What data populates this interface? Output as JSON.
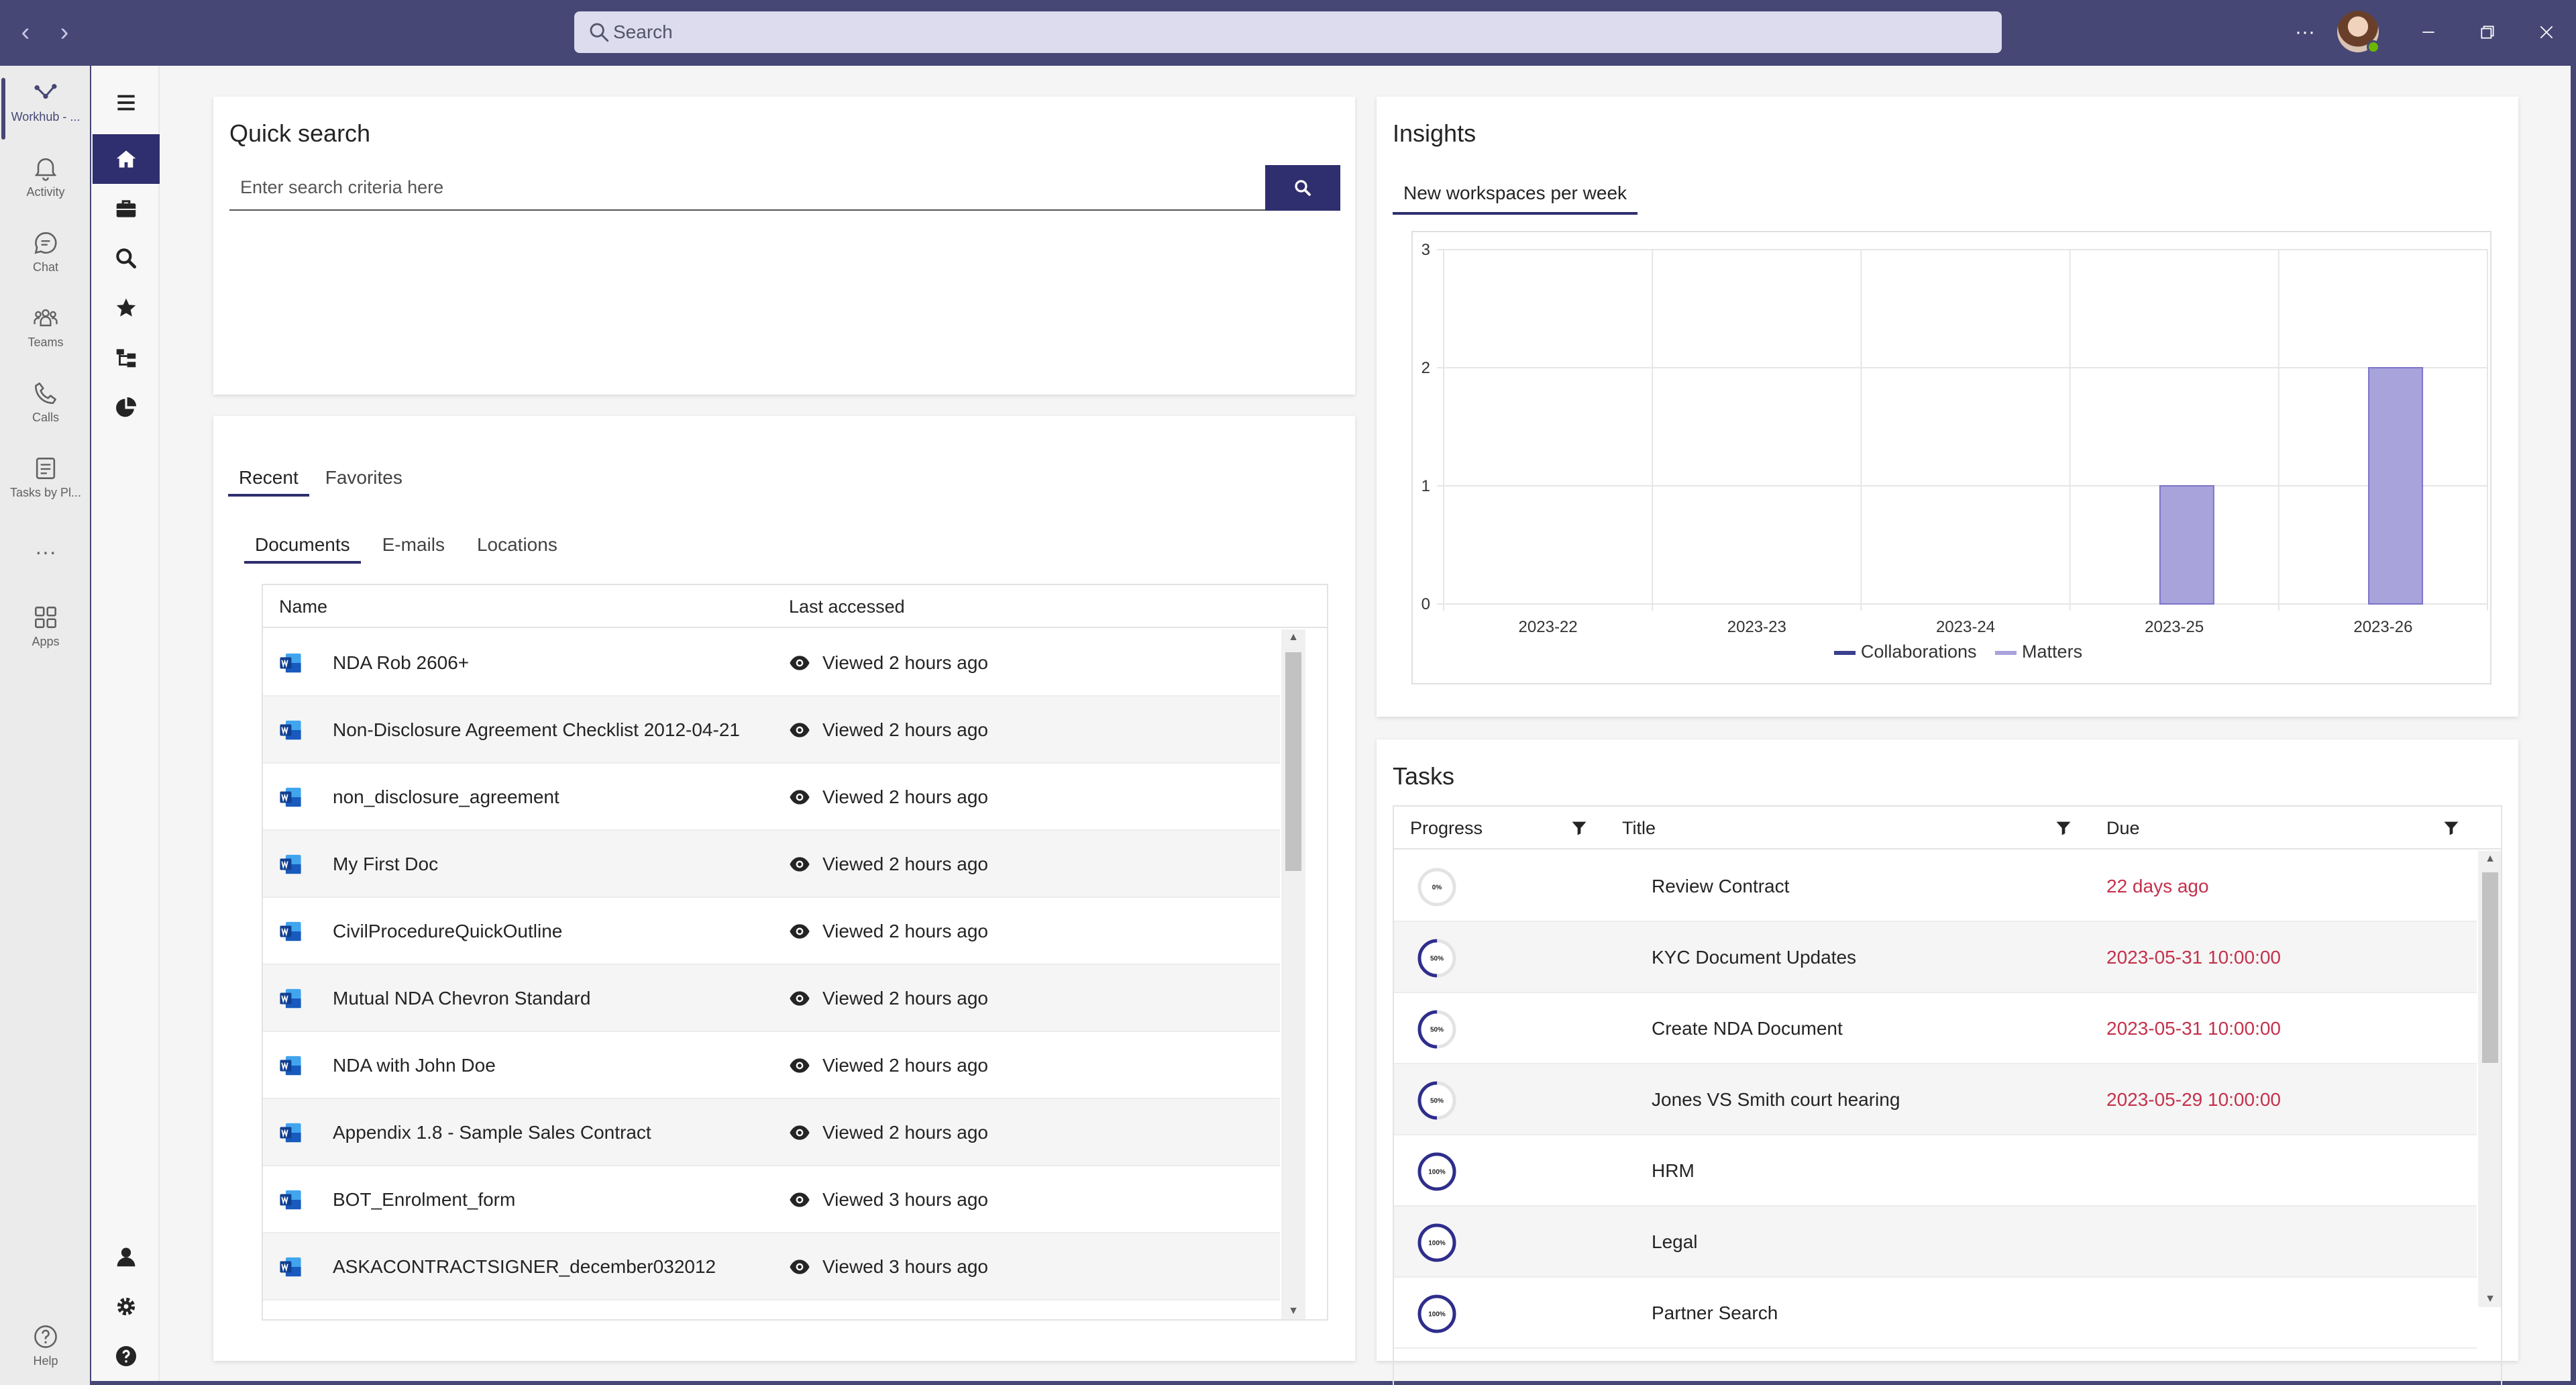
{
  "titlebar": {
    "search_placeholder": "Search",
    "more_label": "···"
  },
  "rail": {
    "items": [
      {
        "label": "Workhub - ...",
        "icon": "workhub-icon"
      },
      {
        "label": "Activity",
        "icon": "bell-icon"
      },
      {
        "label": "Chat",
        "icon": "chat-icon"
      },
      {
        "label": "Teams",
        "icon": "teams-icon"
      },
      {
        "label": "Calls",
        "icon": "phone-icon"
      },
      {
        "label": "Tasks by Pl...",
        "icon": "tasks-icon"
      },
      {
        "label": "···",
        "icon": "more-icon"
      },
      {
        "label": "Apps",
        "icon": "apps-icon"
      },
      {
        "label": "Help",
        "icon": "help-icon"
      }
    ]
  },
  "quick_search": {
    "title": "Quick search",
    "placeholder": "Enter search criteria here"
  },
  "recent": {
    "tabs": [
      "Recent",
      "Favorites"
    ],
    "subtabs": [
      "Documents",
      "E-mails",
      "Locations"
    ],
    "columns": {
      "name": "Name",
      "last_accessed": "Last accessed"
    },
    "rows": [
      {
        "name": "NDA Rob 2606+",
        "accessed": "Viewed 2 hours ago"
      },
      {
        "name": "Non-Disclosure Agreement Checklist 2012-04-21",
        "accessed": "Viewed 2 hours ago"
      },
      {
        "name": "non_disclosure_agreement",
        "accessed": "Viewed 2 hours ago"
      },
      {
        "name": "My First Doc",
        "accessed": "Viewed 2 hours ago"
      },
      {
        "name": "CivilProcedureQuickOutline",
        "accessed": "Viewed 2 hours ago"
      },
      {
        "name": "Mutual NDA Chevron Standard",
        "accessed": "Viewed 2 hours ago"
      },
      {
        "name": "NDA with John Doe",
        "accessed": "Viewed 2 hours ago"
      },
      {
        "name": "Appendix 1.8 - Sample Sales Contract",
        "accessed": "Viewed 2 hours ago"
      },
      {
        "name": "BOT_Enrolment_form",
        "accessed": "Viewed 3 hours ago"
      },
      {
        "name": "ASKACONTRACTSIGNER_december032012",
        "accessed": "Viewed 3 hours ago"
      }
    ]
  },
  "insights": {
    "title": "Insights",
    "tab": "New workspaces per week"
  },
  "chart_data": {
    "type": "bar",
    "categories": [
      "2023-22",
      "2023-23",
      "2023-24",
      "2023-25",
      "2023-26"
    ],
    "series": [
      {
        "name": "Collaborations",
        "values": [
          0,
          0,
          0,
          0,
          0
        ],
        "color": "#3b3f8c"
      },
      {
        "name": "Matters",
        "values": [
          0,
          0,
          0,
          1,
          2
        ],
        "color": "#a9a3dc"
      }
    ],
    "yticks": [
      "0",
      "1",
      "2",
      "3"
    ],
    "ylim": [
      0,
      3
    ],
    "grid": true,
    "legend": "bottom"
  },
  "tasks": {
    "title": "Tasks",
    "columns": {
      "progress": "Progress",
      "title": "Title",
      "due": "Due"
    },
    "rows": [
      {
        "progress": 0,
        "progress_label": "0%",
        "title": "Review Contract",
        "due": "22 days ago"
      },
      {
        "progress": 50,
        "progress_label": "50%",
        "title": "KYC Document Updates",
        "due": "2023-05-31 10:00:00"
      },
      {
        "progress": 50,
        "progress_label": "50%",
        "title": "Create NDA Document",
        "due": "2023-05-31 10:00:00"
      },
      {
        "progress": 50,
        "progress_label": "50%",
        "title": "Jones VS Smith court hearing",
        "due": "2023-05-29 10:00:00"
      },
      {
        "progress": 100,
        "progress_label": "100%",
        "title": "HRM",
        "due": ""
      },
      {
        "progress": 100,
        "progress_label": "100%",
        "title": "Legal",
        "due": ""
      },
      {
        "progress": 100,
        "progress_label": "100%",
        "title": "Partner Search",
        "due": ""
      }
    ]
  },
  "colors": {
    "brand": "#464775",
    "accent": "#2f2e6e",
    "overdue": "#c4314b"
  }
}
